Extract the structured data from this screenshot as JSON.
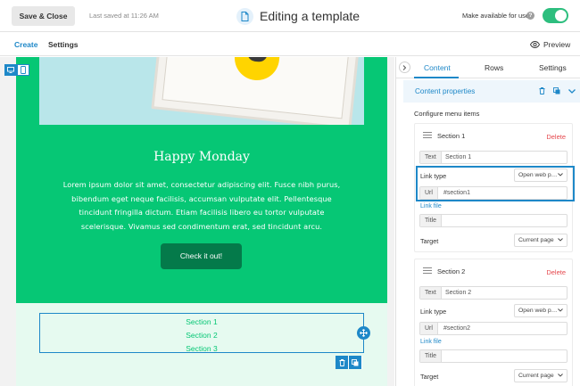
{
  "topbar": {
    "save_close_label": "Save & Close",
    "last_saved": "Last saved at 11:26 AM",
    "title": "Editing a template",
    "available_label": "Make available for use",
    "available_on": true,
    "help_glyph": "?"
  },
  "subbar": {
    "create_label": "Create",
    "settings_label": "Settings",
    "preview_label": "Preview"
  },
  "email": {
    "heading": "Happy Monday",
    "body": "Lorem ipsum dolor sit amet, consectetur adipiscing elit. Fusce nibh purus, bibendum eget neque facilisis, accumsan vulputate elit. Pellentesque tincidunt fringilla dictum. Etiam facilisis libero eu tortor vulputate scelerisque. Vivamus sed condimentum erat, sed tincidunt arcu.",
    "cta_label": "Check it out!",
    "menu_items": [
      "Section 1",
      "Section 2",
      "Section 3"
    ]
  },
  "panel": {
    "tabs": [
      "Content",
      "Rows",
      "Settings"
    ],
    "active_tab": "Content",
    "section_title": "Content properties",
    "configure_label": "Configure menu items",
    "items": [
      {
        "name": "Section 1",
        "delete_label": "Delete",
        "text_label": "Text",
        "text_value": "Section 1",
        "link_type_label": "Link type",
        "link_type_value": "Open web p…",
        "url_label": "Url",
        "url_value": "#section1",
        "link_file_label": "Link file",
        "title_label": "Title",
        "title_value": "",
        "target_label": "Target",
        "target_value": "Current page"
      },
      {
        "name": "Section 2",
        "delete_label": "Delete",
        "text_label": "Text",
        "text_value": "Section 2",
        "link_type_label": "Link type",
        "link_type_value": "Open web p…",
        "url_label": "Url",
        "url_value": "#section2",
        "link_file_label": "Link file",
        "title_label": "Title",
        "title_value": "",
        "target_label": "Target",
        "target_value": "Current page"
      }
    ]
  },
  "colors": {
    "accent": "#1e88c8",
    "email_green": "#06c775",
    "cta_green": "#047a4a",
    "toggle_on": "#2dbe7e",
    "delete_red": "#e5484d"
  },
  "icons": [
    "document-icon",
    "help-icon",
    "eye-icon",
    "desktop-icon",
    "mobile-icon",
    "move-icon",
    "trash-icon",
    "duplicate-icon",
    "chevron-right-icon",
    "chevron-down-icon",
    "drag-handle-icon"
  ]
}
